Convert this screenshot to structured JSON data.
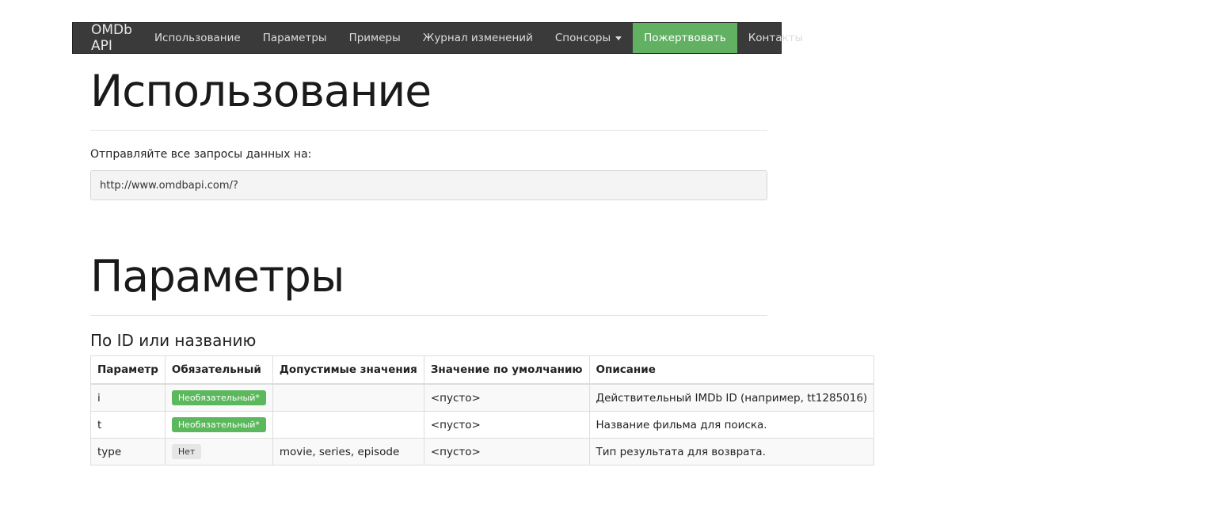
{
  "navbar": {
    "brand": "OMDb API",
    "items": [
      {
        "label": "Использование"
      },
      {
        "label": "Параметры"
      },
      {
        "label": "Примеры"
      },
      {
        "label": "Журнал изменений"
      },
      {
        "label": "Спонсоры"
      },
      {
        "label": "Пожертвовать"
      },
      {
        "label": "Контакты"
      }
    ],
    "active_color": "#62b163"
  },
  "usage": {
    "title": "Использование",
    "intro": "Отправляйте все запросы данных на:",
    "url": "http://www.omdbapi.com/?"
  },
  "params": {
    "title": "Параметры",
    "subtitle": "По ID или названию",
    "headers": [
      "Параметр",
      "Обязательный",
      "Допустимые значения",
      "Значение по умолчанию",
      "Описание"
    ],
    "rows": [
      {
        "param": "i",
        "required": "Необязательный*",
        "values": "",
        "default": "<пусто>",
        "desc": "Действительный IMDb ID (например, tt1285016)"
      },
      {
        "param": "t",
        "required": "Необязательный*",
        "values": "",
        "default": "<пусто>",
        "desc": "Название фильма для поиска."
      },
      {
        "param": "type",
        "required": "Нет",
        "values": "movie, series, episode",
        "default": "<пусто>",
        "desc": "Тип результата для возврата."
      }
    ]
  }
}
